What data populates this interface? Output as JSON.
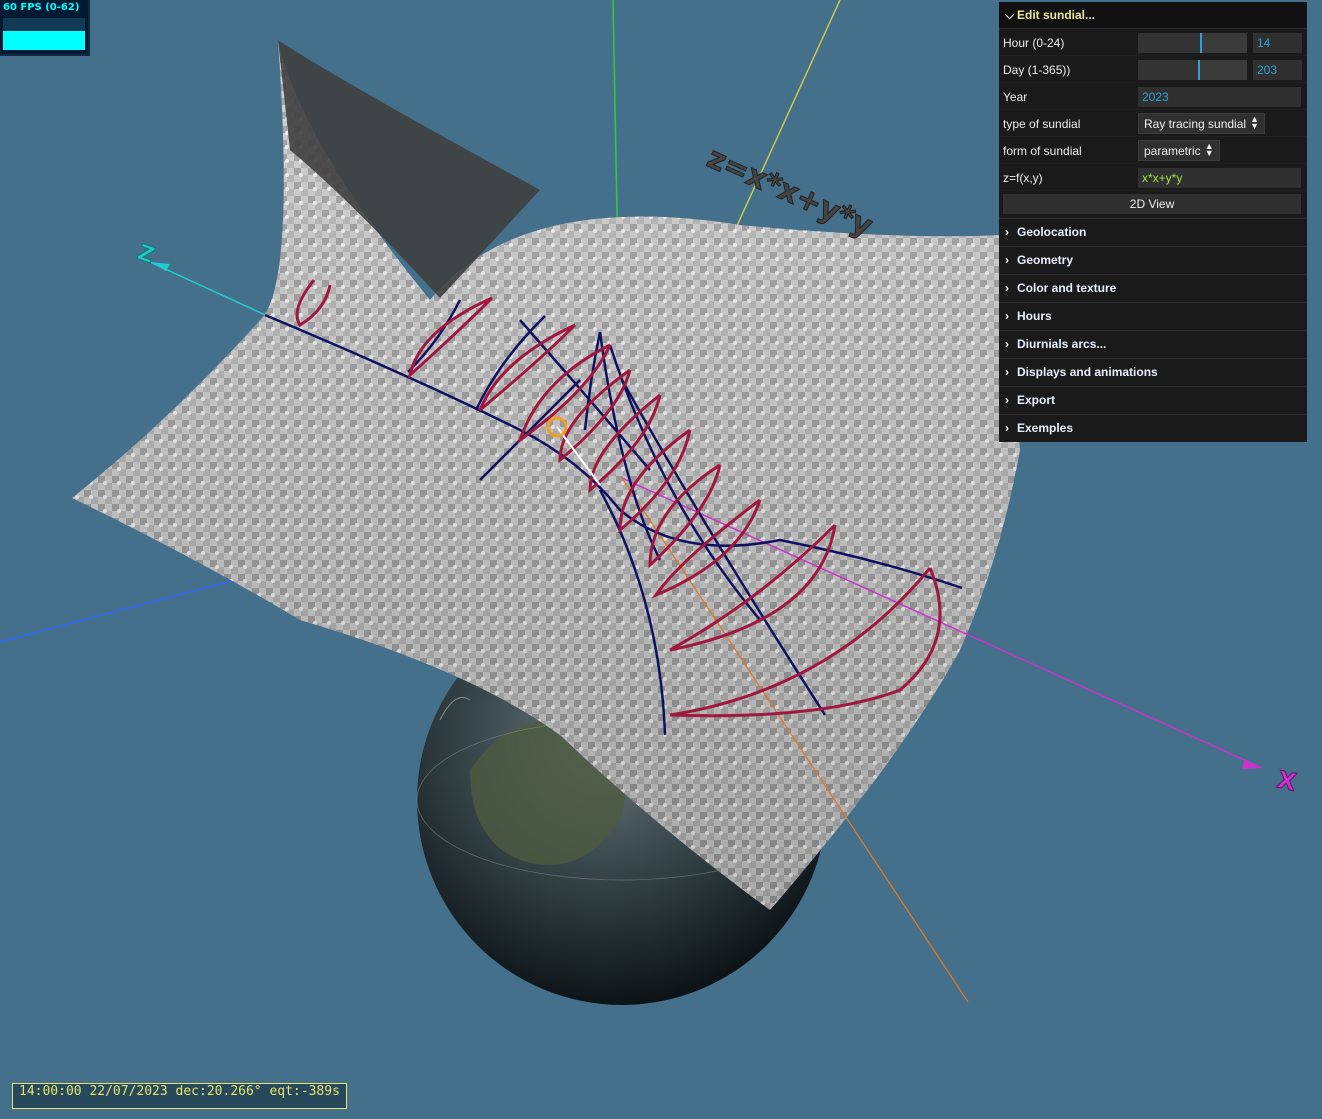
{
  "fps": {
    "label": "60 FPS (0-62)",
    "level": 0.97
  },
  "scene": {
    "surface_label": "z=x*x+y*y",
    "axis_z_label": "Z",
    "axis_x_label": "X"
  },
  "gui": {
    "title": "Edit sundial...",
    "hour": {
      "label": "Hour  (0-24)",
      "value": "14",
      "fraction": 0.58
    },
    "day": {
      "label": "Day (1-365))",
      "value": "203",
      "fraction": 0.56
    },
    "year": {
      "label": "Year",
      "value": "2023"
    },
    "type": {
      "label": "type of sundial",
      "value": "Ray tracing sundial"
    },
    "form": {
      "label": "form of sundial",
      "value": "parametric"
    },
    "func": {
      "label": "z=f(x,y)",
      "value": "x*x+y*y"
    },
    "view_button": "2D View",
    "folders": [
      "Geolocation",
      "Geometry",
      "Color and texture",
      "Hours",
      "Diurnials arcs...",
      "Displays and animations",
      "Export",
      "Exemples"
    ]
  },
  "status": "14:00:00 22/07/2023 dec:20.266° eqt:-389s",
  "colors": {
    "background": "#44708c",
    "accent": "#2fa1d6",
    "axis_x": "#cc33cc",
    "axis_z": "#22cccc",
    "curve_dark": "#101060",
    "curve_red": "#a01840"
  }
}
